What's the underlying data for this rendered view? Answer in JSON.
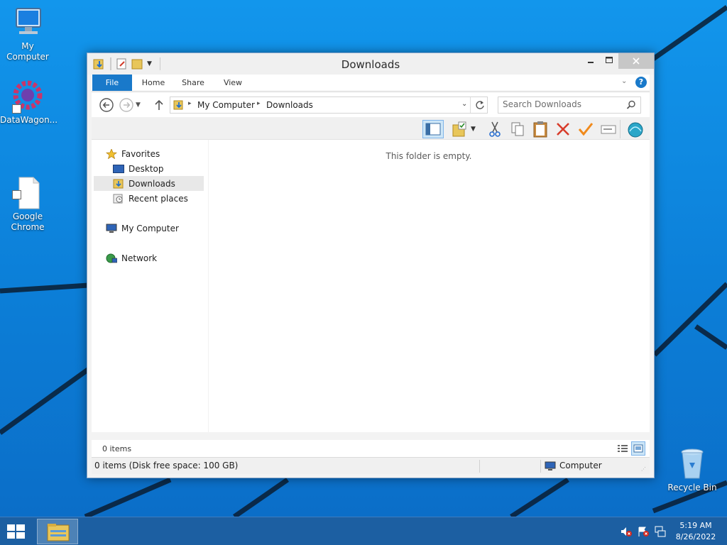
{
  "desktop": {
    "icons": [
      {
        "label": "My Computer"
      },
      {
        "label": "DataWagon..."
      },
      {
        "label": "Google\nChrome"
      },
      {
        "label": "Recycle Bin"
      }
    ]
  },
  "window": {
    "title": "Downloads",
    "ribbon": {
      "tabs": [
        "File",
        "Home",
        "Share",
        "View"
      ]
    },
    "address": {
      "crumbs": [
        "My Computer",
        "Downloads"
      ]
    },
    "search": {
      "placeholder": "Search Downloads"
    },
    "nav": {
      "favorites": "Favorites",
      "desktop": "Desktop",
      "downloads": "Downloads",
      "recent": "Recent places",
      "computer": "My Computer",
      "network": "Network"
    },
    "empty_message": "This folder is empty.",
    "item_count": "0 items",
    "status": {
      "left": "0 items (Disk free space: 100 GB)",
      "right": "Computer"
    }
  },
  "taskbar": {
    "time": "5:19 AM",
    "date": "8/26/2022"
  },
  "colors": {
    "accent": "#1979ca",
    "desktop": "#0c7fd8",
    "taskbar": "#1c5fa2",
    "close_hover": "#c7c7c7"
  }
}
